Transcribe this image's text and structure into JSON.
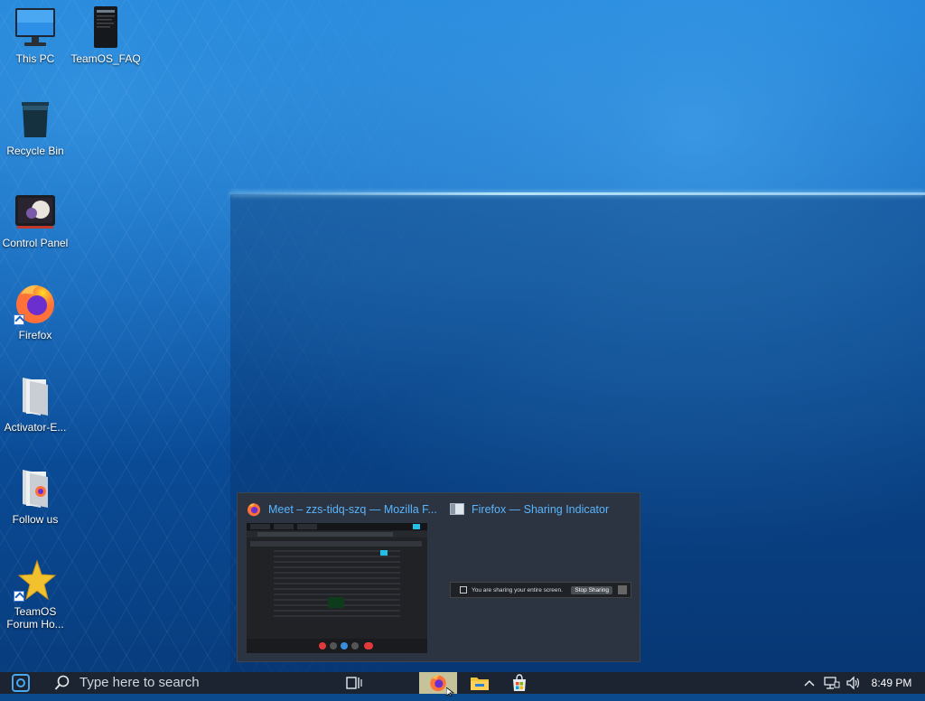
{
  "desktop": {
    "icons": [
      {
        "label": "This PC",
        "icon": "monitor-icon"
      },
      {
        "label": "TeamOS_FAQ",
        "icon": "document-icon"
      },
      {
        "label": "Recycle Bin",
        "icon": "recycle-bin-icon"
      },
      {
        "label": "Control Panel",
        "icon": "control-panel-icon"
      },
      {
        "label": "Firefox",
        "icon": "firefox-icon"
      },
      {
        "label": "Activator-E...",
        "icon": "folder-icon"
      },
      {
        "label": "Follow us",
        "icon": "folder-icon"
      },
      {
        "label": "TeamOS Forum Ho...",
        "icon": "star-icon"
      }
    ]
  },
  "preview": {
    "window1_title": "Meet – zzs-tidq-szq — Mozilla F...",
    "window2_title": "Firefox — Sharing Indicator",
    "sharing_text": "You are sharing your entire screen.",
    "stop_sharing_label": "Stop Sharing"
  },
  "taskbar": {
    "search_placeholder": "Type here to search",
    "clock": "8:49 PM"
  },
  "colors": {
    "accent": "#59b5ff",
    "taskbar_bg": "#1b2430",
    "preview_bg": "#2b3440"
  }
}
